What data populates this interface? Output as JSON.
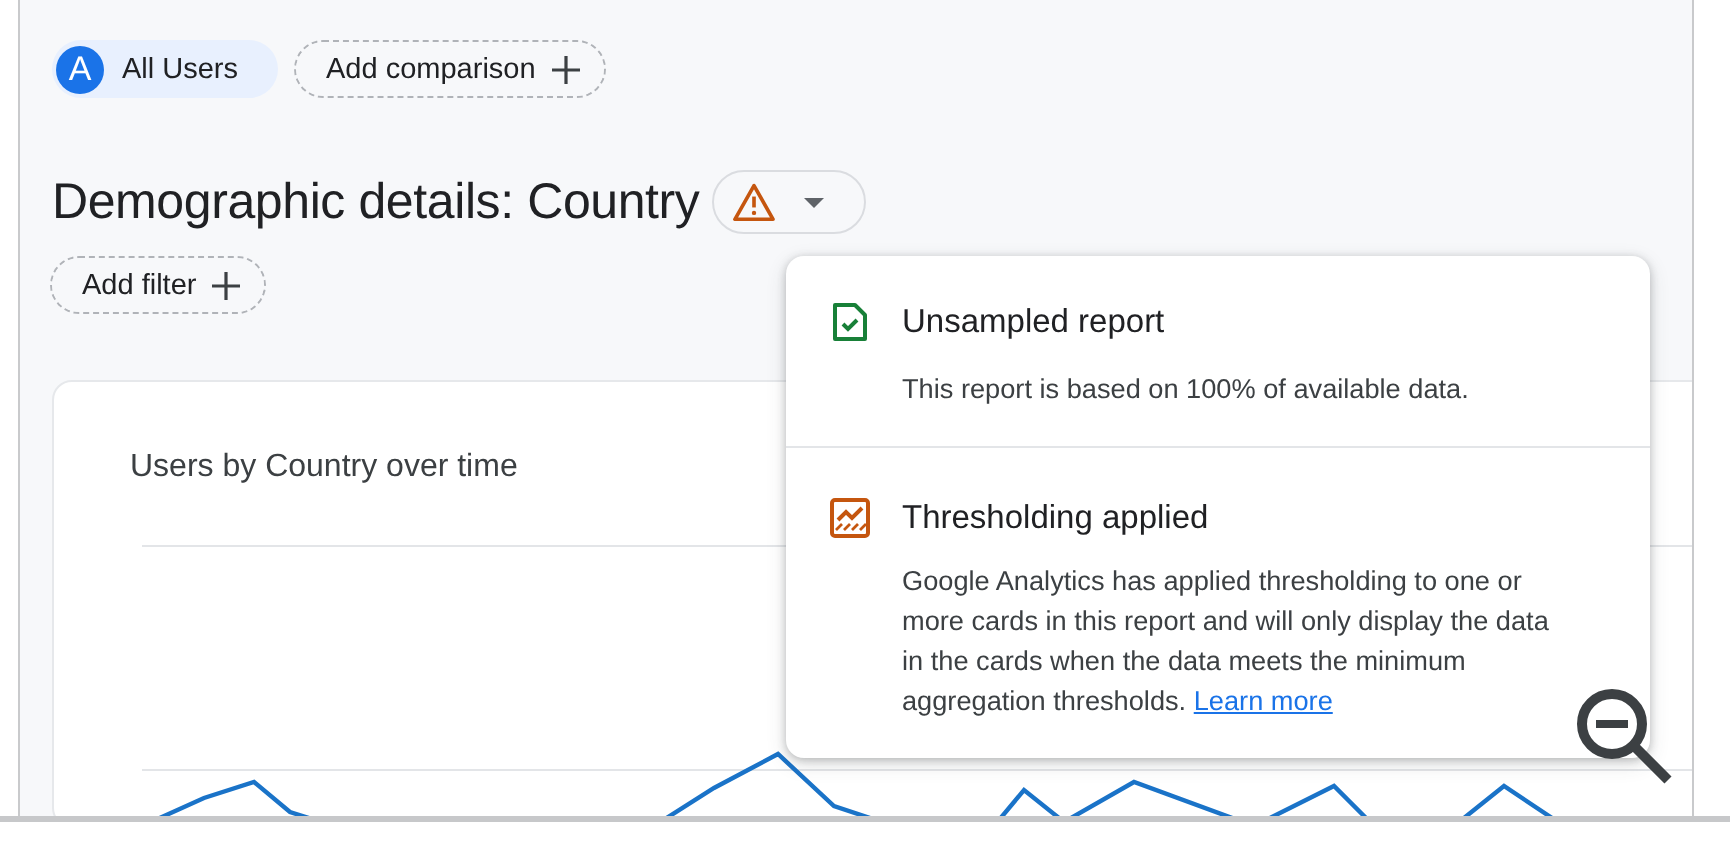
{
  "segments": [
    {
      "avatar": "A",
      "label": "All Users"
    }
  ],
  "add_comparison": {
    "label": "Add comparison"
  },
  "title": "Demographic details: Country",
  "status_button": {
    "kind": "warning"
  },
  "add_filter": {
    "label": "Add filter"
  },
  "card": {
    "title": "Users by Country over time"
  },
  "popup": {
    "sections": [
      {
        "kind": "unsampled",
        "title": "Unsampled report",
        "text": "This report is based on 100% of available data."
      },
      {
        "kind": "thresholding",
        "title": "Thresholding applied",
        "text": "Google Analytics has applied thresholding to one or more cards in this report and will only display the data in the cards when the data meets the minimum aggregation thresholds.",
        "link": "Learn more"
      }
    ]
  }
}
